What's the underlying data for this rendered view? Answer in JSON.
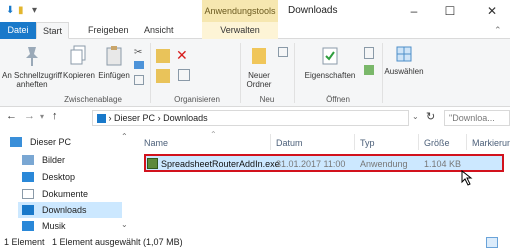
{
  "title": {
    "contextual_tab": "Anwendungstools",
    "window_title": "Downloads",
    "minimize": "–",
    "maximize": "☐",
    "close": "✕"
  },
  "ribbon_tabs": {
    "file": "Datei",
    "start": "Start",
    "share": "Freigeben",
    "view": "Ansicht",
    "manage": "Verwalten"
  },
  "ribbon": {
    "pin": "An Schnellzugriff anheften",
    "copy": "Kopieren",
    "paste": "Einfügen",
    "new_folder": "Neuer Ordner",
    "properties": "Eigenschaften",
    "select": "Auswählen",
    "group_clipboard": "Zwischenablage",
    "group_organize": "Organisieren",
    "group_new": "Neu",
    "group_open": "Öffnen"
  },
  "address": {
    "path_root": "Dieser PC",
    "path_sep": "›",
    "path_current": "Downloads",
    "search_placeholder": "\"Downloa..."
  },
  "nav": {
    "items": [
      {
        "label": "Dieser PC"
      },
      {
        "label": "Bilder"
      },
      {
        "label": "Desktop"
      },
      {
        "label": "Dokumente"
      },
      {
        "label": "Downloads"
      },
      {
        "label": "Musik"
      }
    ]
  },
  "columns": {
    "name": "Name",
    "date": "Datum",
    "type": "Typ",
    "size": "Größe",
    "tags": "Markierun..."
  },
  "files": [
    {
      "name": "SpreadsheetRouterAddIn.exe",
      "date": "31.01.2017 11:00",
      "type": "Anwendung",
      "size": "1.104 KB"
    }
  ],
  "status": {
    "count": "1 Element",
    "selected": "1 Element ausgewählt (1,07 MB)"
  },
  "colors": {
    "accent": "#1979ca",
    "selection": "#cce8ff",
    "highlight_border": "#d2121d",
    "context_tab": "#f6e7b0"
  }
}
